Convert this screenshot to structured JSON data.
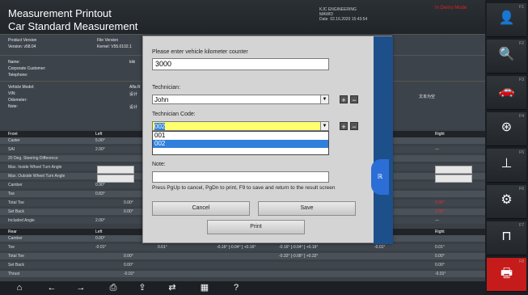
{
  "header": {
    "title1": "Measurement Printout",
    "title2": "Car Standard Measurement",
    "company_name": "KJC ENGINEERING",
    "company_sub": "MAWID",
    "date_label": "Date",
    "date_value": "02.16.2020 15:43:54",
    "demo_label": "In Demo Mode"
  },
  "info": {
    "product_version_label": "Product Version",
    "version": "Version: v58.04",
    "file_version_label": "File Version",
    "kernel": "Kernel: V55.0102.1",
    "name_label": "Name:",
    "name_value": "kiki",
    "corp_label": "Corporate Customer:",
    "tel_label": "Telephone:",
    "vehicle_model_label": "Vehicle Model:",
    "vehicle_model_value": "Alfa R",
    "vin_label": "VIN:",
    "vin_value": "设计",
    "odometer_label": "Odometer:",
    "note_label": "Note:",
    "note_value": "设计",
    "right_note": "文本为空"
  },
  "front": {
    "header": "Front",
    "left": "Left",
    "right": "Right",
    "rows": [
      {
        "label": "Caster",
        "v1": "5.00°"
      },
      {
        "label": "SAI",
        "v1": "2.00°",
        "vr": "---"
      },
      {
        "label": "20 Deg. Steering Difference"
      },
      {
        "label": "Max. Inside Wheel Turn Angle"
      },
      {
        "label": "Max. Outside Wheel Turn Angle"
      },
      {
        "label": "Camber",
        "v1": "0.90°"
      },
      {
        "label": "Toe",
        "v1": "0.83°"
      },
      {
        "label": "Total Toe",
        "v2": "0.00°",
        "vr": "0.00°"
      },
      {
        "label": "Set Back",
        "v2": "0.00°",
        "vr": "0.00°"
      },
      {
        "label": "Included Angle",
        "v1": "2.00°",
        "vr": "---"
      }
    ]
  },
  "rear": {
    "header": "Rear",
    "left": "Left",
    "right": "Right",
    "rows": [
      {
        "label": "Camber",
        "v1": "0.00°"
      },
      {
        "label": "Toe",
        "v1": "-0.01°",
        "v3": "0.01°",
        "mid1": "-0.16°  [-0.04°  ] +0.16°",
        "mid2": "-0.16°  [-0.04°  ] +0.16°",
        "v4": "-0.01°",
        "vr": "0.01°"
      },
      {
        "label": "Total Toe",
        "v2": "0.00°",
        "mid2": "-0.32°  [-0.08°  ] +0.32°",
        "vr": "0.00°"
      },
      {
        "label": "Set Back",
        "v2": "0.00°",
        "vr": "0.00°"
      },
      {
        "label": "Thrust",
        "v2": "-0.01°",
        "vr": "-0.01°"
      }
    ]
  },
  "dialog": {
    "km_label": "Please enter vehicle kilometer counter",
    "km_value": "3000",
    "technician_label": "Technician:",
    "technician_value": "John",
    "tech_code_label": "Technician Code:",
    "tech_code_value": "002",
    "codes": [
      "001",
      "002"
    ],
    "plus": "+",
    "minus": "−",
    "note_label": "Note:",
    "note_value": "",
    "hint": "Press PgUp to cancel, PgDn to print, F9 to save and return to the result screen",
    "cancel": "Cancel",
    "save": "Save",
    "print": "Print",
    "brand_glyph": "ℝ"
  },
  "sidebar": {
    "items": [
      {
        "key": "F1",
        "icon": "person-icon",
        "glyph": "👤"
      },
      {
        "key": "F2",
        "icon": "wheel-search-icon",
        "glyph": "🔍"
      },
      {
        "key": "F3",
        "icon": "car-lift-icon",
        "glyph": "🚗"
      },
      {
        "key": "F4",
        "icon": "steering-wheel-icon",
        "glyph": "⊛"
      },
      {
        "key": "F5",
        "icon": "axle-icon",
        "glyph": "⊥"
      },
      {
        "key": "F6",
        "icon": "wheel-adjust-icon",
        "glyph": "⚙"
      },
      {
        "key": "F7",
        "icon": "lift-icon",
        "glyph": "⊓"
      },
      {
        "key": "F8",
        "icon": "printer-icon",
        "glyph": "🖶"
      }
    ]
  },
  "toolbar": {
    "items": [
      {
        "name": "home-icon",
        "glyph": "⌂"
      },
      {
        "name": "back-icon",
        "glyph": "←"
      },
      {
        "name": "forward-icon",
        "glyph": "→"
      },
      {
        "name": "print-icon",
        "glyph": "⎙"
      },
      {
        "name": "upload-icon",
        "glyph": "⇪"
      },
      {
        "name": "swap-icon",
        "glyph": "⇄"
      },
      {
        "name": "calculator-icon",
        "glyph": "▦"
      },
      {
        "name": "help-icon",
        "glyph": "?"
      }
    ]
  }
}
